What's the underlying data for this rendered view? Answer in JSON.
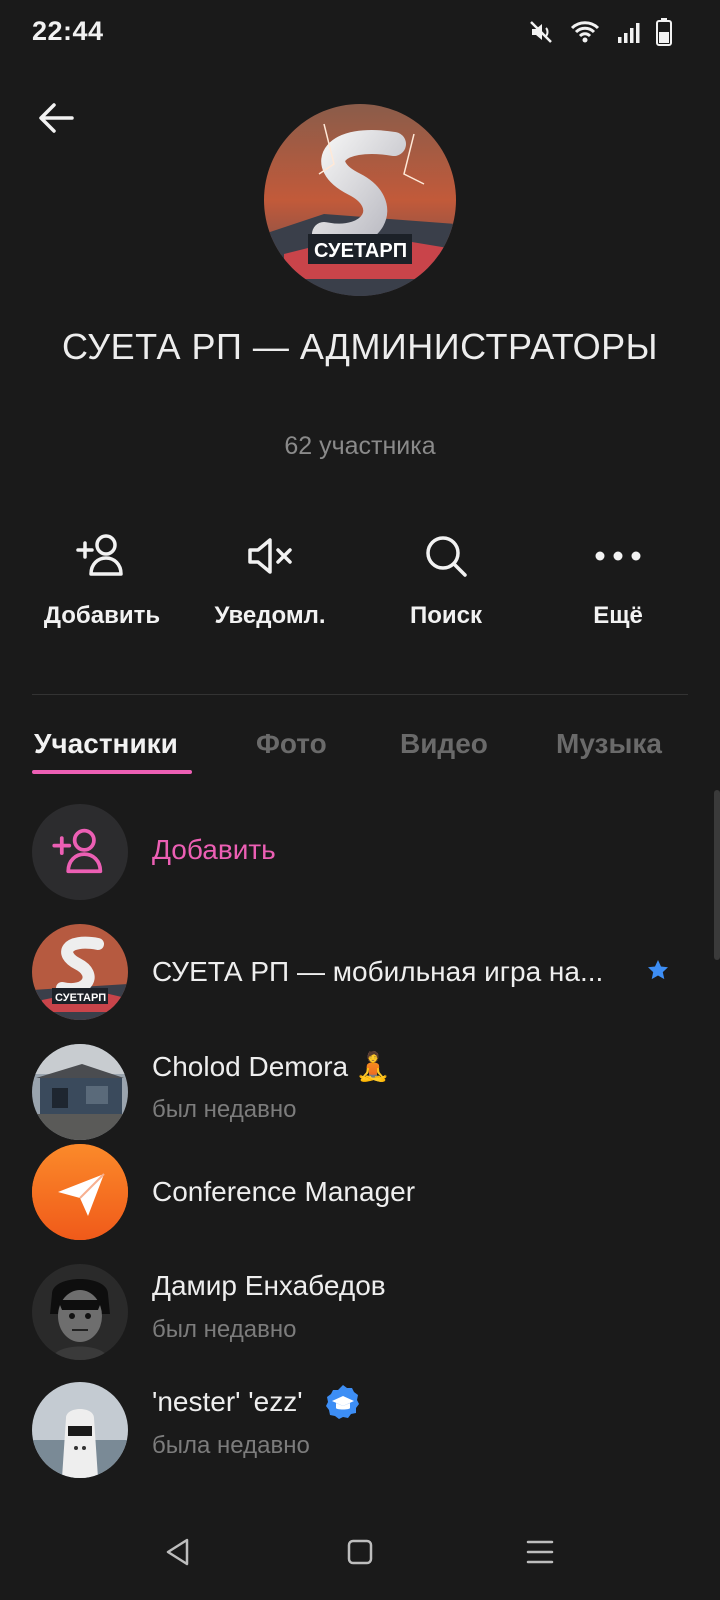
{
  "status_bar": {
    "time": "22:44",
    "icons": [
      "mute-icon",
      "wifi-icon",
      "signal-icon",
      "battery-icon"
    ]
  },
  "header": {
    "back_icon": "arrow-left-icon",
    "title": "СУЕТА РП — АДМИНИСТРАТОРЫ",
    "subtitle": "62 участника",
    "avatar_text": "СУЕТАРП"
  },
  "actions": [
    {
      "label": "Добавить",
      "icon": "add-user-icon"
    },
    {
      "label": "Уведомл.",
      "icon": "speaker-off-icon"
    },
    {
      "label": "Поиск",
      "icon": "search-icon"
    },
    {
      "label": "Ещё",
      "icon": "more-dots-icon"
    }
  ],
  "tabs": [
    {
      "label": "Участники",
      "active": true
    },
    {
      "label": "Фото",
      "active": false
    },
    {
      "label": "Видео",
      "active": false
    },
    {
      "label": "Музыка",
      "active": false
    }
  ],
  "members": {
    "add_label": "Добавить",
    "items": [
      {
        "name": "СУЕТА РП — мобильная игра на...",
        "status": "",
        "badge": "star-icon",
        "avatar_text": "СУЕТАРП"
      },
      {
        "name": "Cholod Demora 🧘",
        "status": "был недавно",
        "badge": ""
      },
      {
        "name": "Conference Manager",
        "status": "",
        "badge": ""
      },
      {
        "name": "Дамир Енхабедов",
        "status": "был недавно",
        "badge": ""
      },
      {
        "name": "'nester' 'ezz'",
        "status": "была недавно",
        "badge": "graduation-cap-icon"
      }
    ]
  },
  "colors": {
    "background": "#1a1a1a",
    "accent": "#ec5fb4",
    "muted_text": "#7c7c7c",
    "verified_blue": "#3d8ef5"
  },
  "nav_bar": [
    "back-triangle-icon",
    "home-square-icon",
    "menu-lines-icon"
  ]
}
